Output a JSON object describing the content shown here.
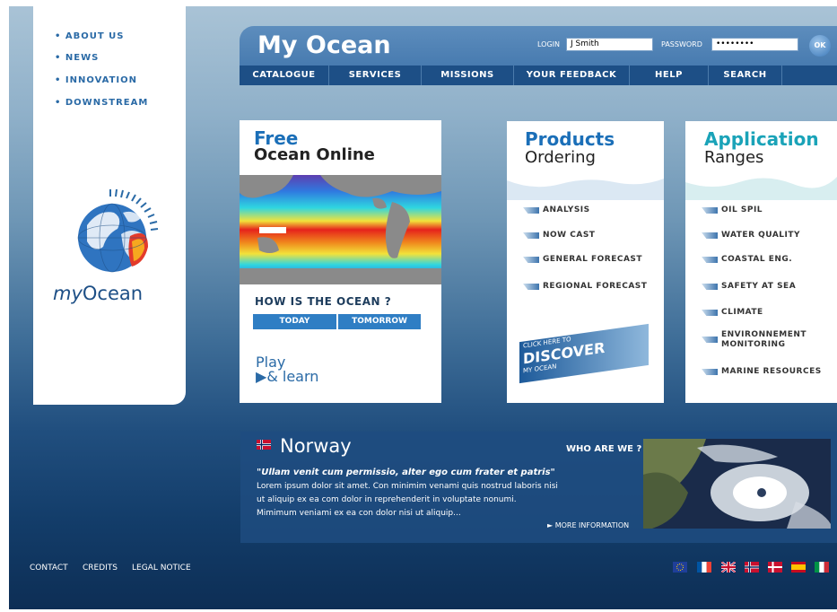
{
  "left_nav": [
    "ABOUT US",
    "NEWS",
    "INNOVATION",
    "DOWNSTREAM"
  ],
  "logo": {
    "my": "my",
    "ocean": "Ocean"
  },
  "header": {
    "title": "My Ocean",
    "login_label": "LOGIN",
    "login_value": "J Smith",
    "password_label": "PASSWORD",
    "password_value": "••••••••",
    "ok_label": "OK"
  },
  "nav": [
    "CATALOGUE",
    "SERVICES",
    "MISSIONS",
    "YOUR FEEDBACK",
    "HELP",
    "SEARCH"
  ],
  "free_card": {
    "heading1": "Free",
    "heading2": "Ocean Online",
    "question": "HOW IS THE OCEAN ?",
    "today": "TODAY",
    "tomorrow": "TOMORROW",
    "play1": "Play",
    "play2": "& learn"
  },
  "products_card": {
    "heading1": "Products",
    "heading2": "Ordering",
    "items": [
      "ANALYSIS",
      "NOW CAST",
      "GENERAL FORECAST",
      "REGIONAL FORECAST"
    ],
    "discover_small": "CLICK HERE TO",
    "discover_big": "DISCOVER",
    "discover_sub": "MY OCEAN"
  },
  "ranges_card": {
    "heading1": "Application",
    "heading2": "Ranges",
    "items": [
      "OIL SPIL",
      "WATER QUALITY",
      "COASTAL ENG.",
      "SAFETY AT SEA",
      "CLIMATE",
      "ENVIRONNEMENT MONITORING",
      "MARINE RESOURCES"
    ]
  },
  "news": {
    "title": "Norway",
    "who": "WHO ARE WE ?",
    "quote": "\"Ullam venit cum permissio, alter ego cum frater et patris\"",
    "lines": [
      "Lorem ipsum dolor sit amet. Con minimim venami quis nostrud laboris nisi",
      "ut aliquip ex ea com dolor in reprehenderit in voluptate nonumi.",
      "Mimimum veniami ex ea con dolor nisi ut aliquip..."
    ],
    "more": "► MORE INFORMATION"
  },
  "footer": {
    "links": [
      "CONTACT",
      "CREDITS",
      "LEGAL NOTICE"
    ]
  },
  "flags": [
    "eu-flag",
    "france-flag",
    "uk-flag",
    "norway-flag",
    "denmark-flag",
    "spain-flag",
    "italy-flag"
  ],
  "colors": {
    "accent": "#1b6fb8",
    "nav_bg": "#1d4f86",
    "header_bg": "#3d72a9"
  }
}
